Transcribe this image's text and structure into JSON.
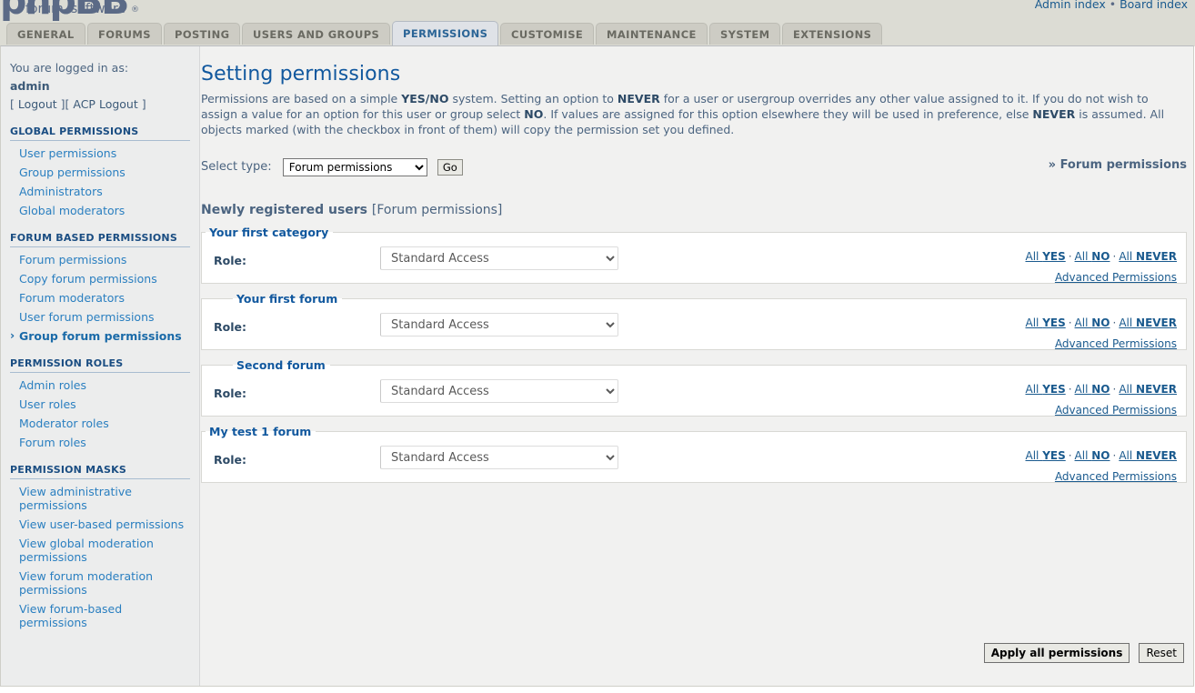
{
  "masthead": {
    "logo_word": "phpBB",
    "logo_sub_left": "forum",
    "logo_sub_right": "software",
    "logo_reg": "®",
    "admin_index": "Admin index",
    "admin_sep": "•",
    "board_index": "Board index"
  },
  "tabs": [
    {
      "label": "GENERAL",
      "active": false
    },
    {
      "label": "FORUMS",
      "active": false
    },
    {
      "label": "POSTING",
      "active": false
    },
    {
      "label": "USERS AND GROUPS",
      "active": false
    },
    {
      "label": "PERMISSIONS",
      "active": true
    },
    {
      "label": "CUSTOMISE",
      "active": false
    },
    {
      "label": "MAINTENANCE",
      "active": false
    },
    {
      "label": "SYSTEM",
      "active": false
    },
    {
      "label": "EXTENSIONS",
      "active": false
    }
  ],
  "sidebar": {
    "logged_in_as": "You are logged in as:",
    "username": "admin",
    "logout_open": "[ ",
    "logout": "Logout",
    "logout_mid": " ][ ",
    "acp_logout": "ACP Logout",
    "logout_close": " ]",
    "groups": [
      {
        "heading": "GLOBAL PERMISSIONS",
        "items": [
          {
            "label": "User permissions",
            "current": false
          },
          {
            "label": "Group permissions",
            "current": false
          },
          {
            "label": "Administrators",
            "current": false
          },
          {
            "label": "Global moderators",
            "current": false
          }
        ]
      },
      {
        "heading": "FORUM BASED PERMISSIONS",
        "items": [
          {
            "label": "Forum permissions",
            "current": false
          },
          {
            "label": "Copy forum permissions",
            "current": false
          },
          {
            "label": "Forum moderators",
            "current": false
          },
          {
            "label": "User forum permissions",
            "current": false
          },
          {
            "label": "Group forum permissions",
            "current": true
          }
        ]
      },
      {
        "heading": "PERMISSION ROLES",
        "items": [
          {
            "label": "Admin roles",
            "current": false
          },
          {
            "label": "User roles",
            "current": false
          },
          {
            "label": "Moderator roles",
            "current": false
          },
          {
            "label": "Forum roles",
            "current": false
          }
        ]
      },
      {
        "heading": "PERMISSION MASKS",
        "items": [
          {
            "label": "View administrative permissions",
            "current": false
          },
          {
            "label": "View user-based permissions",
            "current": false
          },
          {
            "label": "View global moderation permissions",
            "current": false
          },
          {
            "label": "View forum moderation permissions",
            "current": false
          },
          {
            "label": "View forum-based permissions",
            "current": false
          }
        ]
      }
    ]
  },
  "main": {
    "title": "Setting permissions",
    "intro_parts": [
      {
        "text": "Permissions are based on a simple ",
        "bold": false
      },
      {
        "text": "YES/NO",
        "bold": true
      },
      {
        "text": " system. Setting an option to ",
        "bold": false
      },
      {
        "text": "NEVER",
        "bold": true
      },
      {
        "text": " for a user or usergroup overrides any other value assigned to it. If you do not wish to assign a value for an option for this user or group select ",
        "bold": false
      },
      {
        "text": "NO",
        "bold": true
      },
      {
        "text": ". If values are assigned for this option elsewhere they will be used in preference, else ",
        "bold": false
      },
      {
        "text": "NEVER",
        "bold": true
      },
      {
        "text": " is assumed. All objects marked (with the checkbox in front of them) will copy the permission set you defined.",
        "bold": false
      }
    ],
    "select_type_label": "Select type:",
    "select_type_value": "Forum permissions",
    "select_type_options": [
      "Forum permissions"
    ],
    "go_label": "Go",
    "breadcrumb_right": "» Forum permissions",
    "group_title": "Newly registered users",
    "group_title_suffix": "[Forum permissions]",
    "role_label": "Role:",
    "actions": {
      "all_prefix": "All ",
      "yes": "YES",
      "no": "NO",
      "never": "NEVER",
      "separator": "·",
      "advanced": "Advanced Permissions"
    },
    "panels": [
      {
        "name": "Your first category",
        "role": "Standard Access",
        "indent": false
      },
      {
        "name": "Your first forum",
        "role": "Standard Access",
        "indent": true
      },
      {
        "name": "Second forum",
        "role": "Standard Access",
        "indent": true
      },
      {
        "name": "My test 1 forum",
        "role": "Standard Access",
        "indent": false
      }
    ],
    "role_options": [
      "Standard Access"
    ],
    "apply_label": "Apply all permissions",
    "reset_label": "Reset"
  },
  "colors": {
    "accent": "#11589e",
    "link": "#2a7fc0",
    "tab_active_text": "#2a6496",
    "masthead_bg": "#dcdcd4",
    "page_bg": "#f1f1f0"
  }
}
